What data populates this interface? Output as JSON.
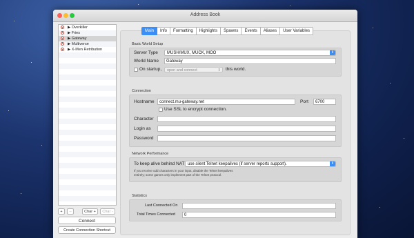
{
  "window": {
    "title": "Address Book"
  },
  "sidebar": {
    "items": [
      {
        "label": "▶ Overkiller"
      },
      {
        "label": "▶ Fries"
      },
      {
        "label": "▶ Gateway"
      },
      {
        "label": "▶ Multiverse"
      },
      {
        "label": "▶ X-Men Retribution"
      }
    ],
    "selected_index": 2,
    "add_label": "+",
    "remove_label": "–",
    "char_add_label": "Char +",
    "char_remove_label": "Char -",
    "connect_label": "Connect",
    "shortcut_label": "Create Connection Shortcut"
  },
  "tabs": [
    {
      "label": "Main",
      "active": true
    },
    {
      "label": "Info"
    },
    {
      "label": "Formatting"
    },
    {
      "label": "Highlights"
    },
    {
      "label": "Spawns"
    },
    {
      "label": "Events"
    },
    {
      "label": "Aliases"
    },
    {
      "label": "User Variables"
    }
  ],
  "basic": {
    "section_label": "Basic World Setup",
    "server_type_label": "Server Type",
    "server_type_value": "MUSH/MUX, MUCK, MOO",
    "world_name_label": "World Name",
    "world_name_value": "Gateway",
    "on_startup_label": "On startup,",
    "on_startup_value": "open and connect",
    "this_world_label": "this world."
  },
  "connection": {
    "section_label": "Connection",
    "hostname_label": "Hostname",
    "hostname_value": "connect.mu-gateway.net",
    "port_label": "Port",
    "port_value": "6700",
    "ssl_label": "Use SSL to encrypt connection.",
    "character_label": "Character",
    "login_label": "Login as",
    "password_label": "Password"
  },
  "network": {
    "section_label": "Network Performance",
    "keepalive_label": "To keep alive behind NAT",
    "keepalive_value": "use silent Telnet keepalives (if server reports support).",
    "note_line1": "If you receive odd characters in your input, disable the Telnet keepalives",
    "note_line2": "entirely; some games only implement part of the Telnet protocol."
  },
  "statistics": {
    "section_label": "Statistics",
    "last_connected_label": "Last Connected On",
    "last_connected_value": "",
    "total_times_label": "Total Times Connected",
    "total_times_value": "0"
  },
  "colors": {
    "accent": "#3b8ef5",
    "selection": "#d4d4d4"
  }
}
